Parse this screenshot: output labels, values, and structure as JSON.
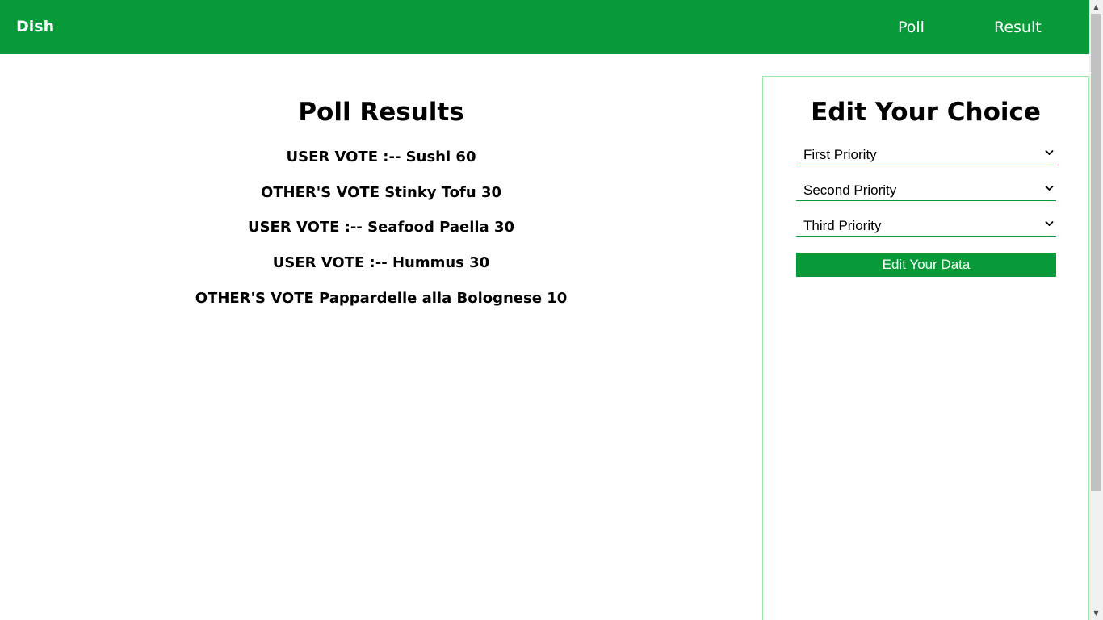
{
  "navbar": {
    "brand": "Dish",
    "links": [
      "Poll",
      "Result"
    ],
    "color": "#089a38"
  },
  "results": {
    "title": "Poll Results",
    "votes": [
      "USER VOTE :-- Sushi 60",
      "OTHER'S VOTE Stinky Tofu 30",
      "USER VOTE :-- Seafood Paella 30",
      "USER VOTE :-- Hummus 30",
      "OTHER'S VOTE Pappardelle alla Bolognese 10"
    ]
  },
  "edit": {
    "title": "Edit Your Choice",
    "selects": [
      "First Priority",
      "Second Priority",
      "Third Priority"
    ],
    "button_label": "Edit Your Data"
  },
  "icons": {
    "select_chevron": "chevron-down-icon",
    "scroll_up": "triangle-up-icon",
    "scroll_down": "triangle-down-icon"
  }
}
